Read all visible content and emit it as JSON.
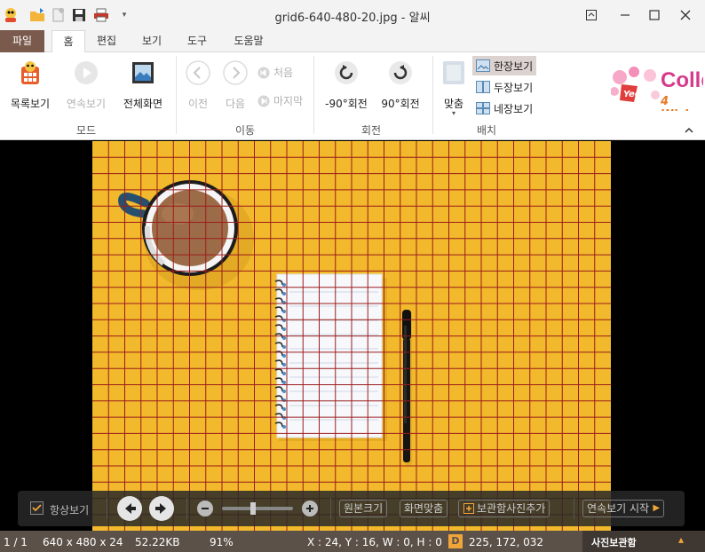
{
  "window": {
    "title": "grid6-640-480-20.jpg - 알씨"
  },
  "tabs": [
    "파일",
    "홈",
    "편집",
    "보기",
    "도구",
    "도움말"
  ],
  "ribbon": {
    "mode": {
      "label": "모드",
      "list_view": "목록보기",
      "slideshow": "연속보기",
      "fullscreen": "전체화면"
    },
    "move": {
      "label": "이동",
      "prev": "이전",
      "next": "다음",
      "first": "처음",
      "last": "마지막"
    },
    "rotate": {
      "label": "회전",
      "ccw": "-90°회전",
      "cw": "90°회전"
    },
    "layout": {
      "label": "배치",
      "fit": "맞춤",
      "one": "한장보기",
      "two": "두장보기",
      "four": "네장보기"
    },
    "ad": {
      "brand": "Yeo's",
      "line1": "Colle",
      "line2": "4 Wishe"
    }
  },
  "floatbar": {
    "always_show": "항상보기",
    "original_size": "원본크기",
    "fit_screen": "화면맞춤",
    "add_to_album": "보관함사진추가",
    "start_slideshow": "연속보기 시작"
  },
  "statusbar": {
    "index": "1 / 1",
    "dimensions": "640 x 480 x 24",
    "filesize": "52.22KB",
    "zoom": "91%",
    "coords": "X : 24, Y : 16, W : 0, H : 0",
    "color_badge": "D",
    "color_value": "225, 172, 032",
    "album": "사진보관함"
  },
  "colors": {
    "accent": "#7a5a4c",
    "photo_bg": "#f1b92b",
    "grid": "#9b1c1c"
  }
}
